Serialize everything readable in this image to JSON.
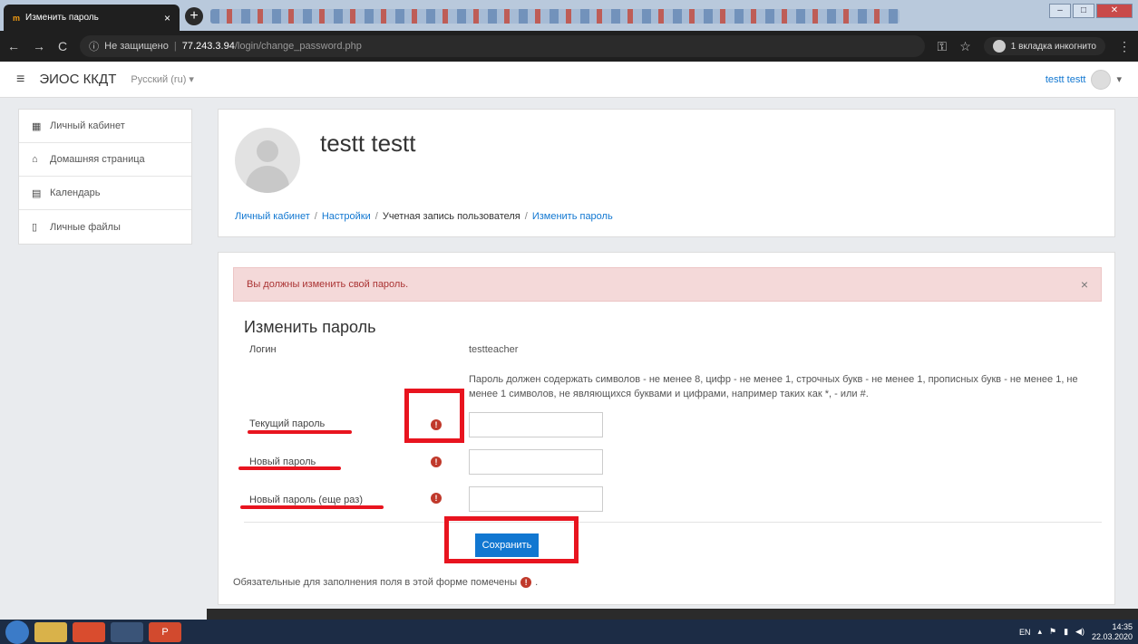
{
  "browser": {
    "tab_title": "Изменить пароль",
    "tab_favicon": "m",
    "url_warning": "Не защищено",
    "url_host": "77.243.3.94",
    "url_path": "/login/change_password.php",
    "incognito_label": "1 вкладка инкогнито"
  },
  "header": {
    "brand": "ЭИОС ККДТ",
    "language": "Русский (ru) ▾",
    "user_name": "testt testt"
  },
  "sidebar": {
    "items": [
      {
        "label": "Личный кабинет",
        "icon": "dashboard-icon"
      },
      {
        "label": "Домашняя страница",
        "icon": "home-icon"
      },
      {
        "label": "Календарь",
        "icon": "calendar-icon"
      },
      {
        "label": "Личные файлы",
        "icon": "file-icon"
      }
    ]
  },
  "page": {
    "user_full_name": "testt testt",
    "breadcrumbs": [
      "Личный кабинет",
      "Настройки",
      "Учетная запись пользователя",
      "Изменить пароль"
    ]
  },
  "form": {
    "alert": "Вы должны изменить свой пароль.",
    "title": "Изменить пароль",
    "login_label": "Логин",
    "login_value": "testteacher",
    "rules": "Пароль должен содержать символов - не менее 8, цифр - не менее 1, строчных букв - не менее 1, прописных букв - не менее 1, не менее 1 символов, не являющихся буквами и цифрами, например таких как *, - или #.",
    "current_password_label": "Текущий пароль",
    "new_password_label": "Новый пароль",
    "new_password_again_label": "Новый пароль (еще раз)",
    "save_label": "Сохранить",
    "required_note": "Обязательные для заполнения поля в этой форме помечены",
    "required_note_end": "."
  },
  "taskbar": {
    "lang": "EN",
    "time": "14:35",
    "date": "22.03.2020"
  },
  "colors": {
    "accent": "#1177d1",
    "required": "#c0392b",
    "alert_bg": "#f4d9d9",
    "annotation": "#e8141f"
  }
}
